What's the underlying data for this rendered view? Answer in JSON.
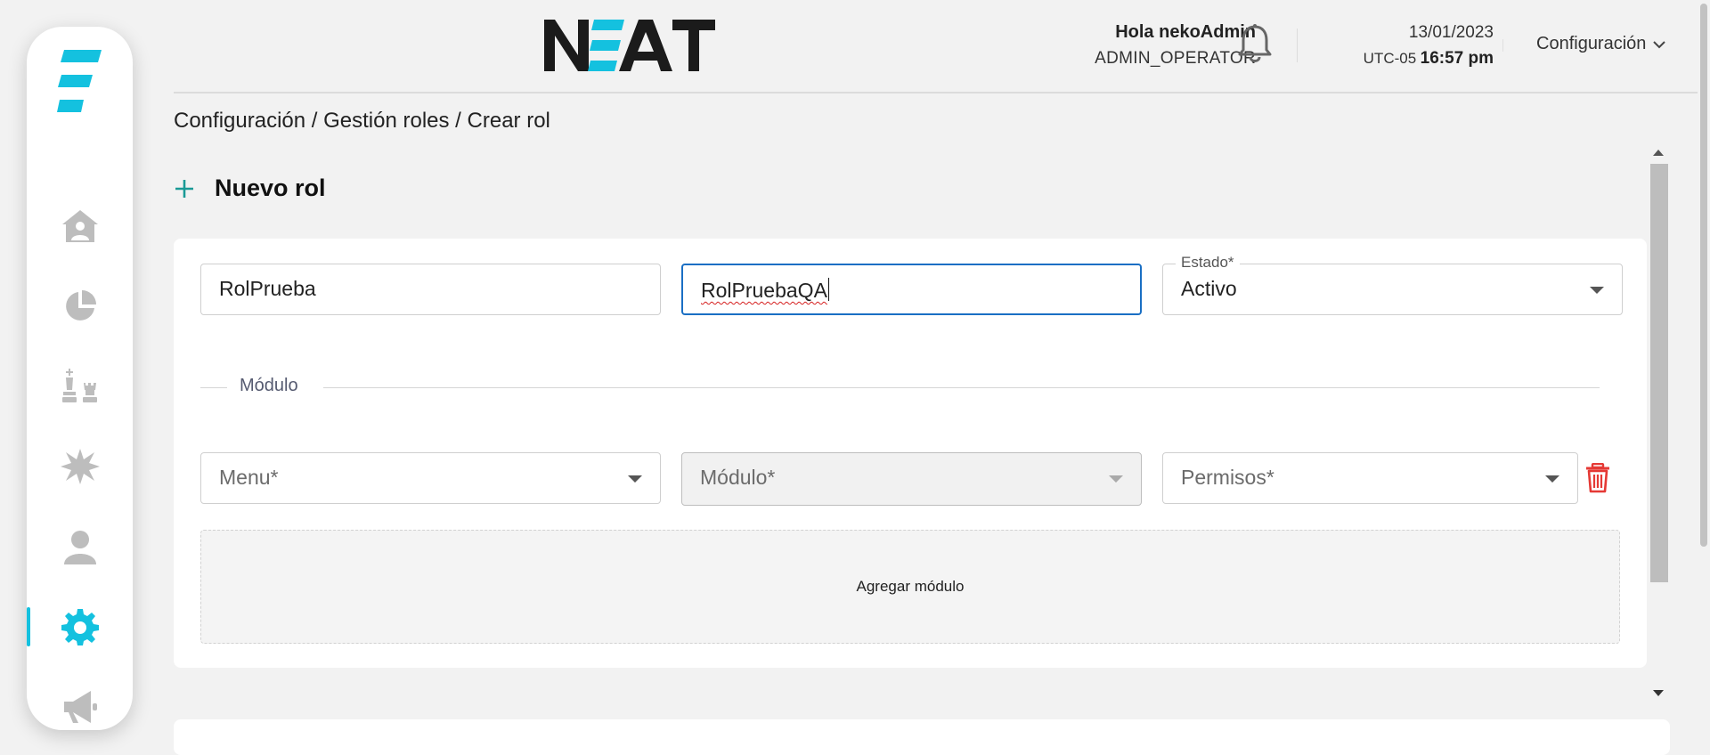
{
  "colors": {
    "accent": "#14c1df",
    "active_icon": "#14c1df",
    "focus_border": "#1a6fc4",
    "trash": "#e53935",
    "plus": "#1a9a96"
  },
  "sidebar": {
    "items": [
      {
        "icon": "home-user-icon",
        "active": false
      },
      {
        "icon": "pie-chart-icon",
        "active": false
      },
      {
        "icon": "chess-pieces-icon",
        "active": false
      },
      {
        "icon": "burst-icon",
        "active": false
      },
      {
        "icon": "user-icon",
        "active": false
      },
      {
        "icon": "gear-icon",
        "active": true
      },
      {
        "icon": "megaphone-icon",
        "active": false
      }
    ]
  },
  "header": {
    "brand": "NEAT",
    "greeting": "Hola nekoAdmin",
    "role": "ADMIN_OPERATOR",
    "date": "13/01/2023",
    "timezone": "UTC-05",
    "time": "16:57 pm",
    "config_menu": "Configuración"
  },
  "breadcrumb": [
    "Configuración",
    "Gestión roles",
    "Crear rol"
  ],
  "breadcrumb_separator": " / ",
  "page_title": "Nuevo rol",
  "form": {
    "name_value": "RolPrueba",
    "description_value": "RolPruebaQA",
    "estado_label": "Estado*",
    "estado_value": "Activo",
    "section_label": "Módulo",
    "menu_placeholder": "Menu*",
    "modulo_placeholder": "Módulo*",
    "permisos_placeholder": "Permisos*",
    "add_module_label": "Agregar módulo"
  }
}
